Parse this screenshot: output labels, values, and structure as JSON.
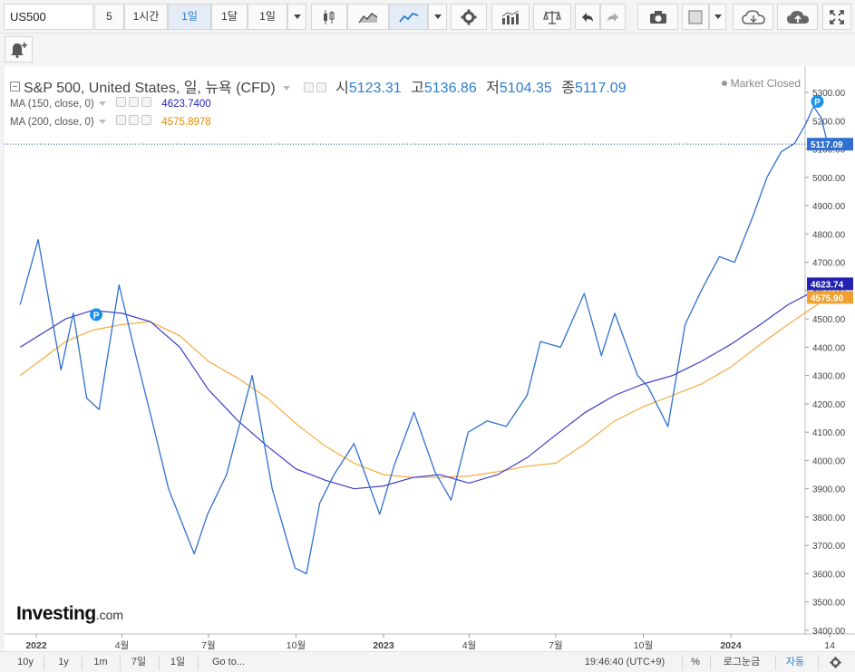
{
  "toolbar": {
    "symbol": "US500",
    "intervals": [
      "5",
      "1시간",
      "1일",
      "1달",
      "1일"
    ],
    "active_interval_index": 2,
    "icons": [
      "candlestick-icon",
      "area-chart-icon",
      "line-chart-icon",
      "settings-icon",
      "bar-indicator-icon",
      "scale-icon",
      "undo-icon",
      "redo-icon",
      "camera-icon",
      "color-box-icon",
      "cloud-download-icon",
      "cloud-upload-icon",
      "fullscreen-icon"
    ]
  },
  "alert_icon": "bell-plus-icon",
  "header": {
    "title": "S&P 500, United States, 일, 뉴욕 (CFD)",
    "ohlc": [
      {
        "label": "시",
        "value": "5123.31"
      },
      {
        "label": "고",
        "value": "5136.86"
      },
      {
        "label": "저",
        "value": "5104.35"
      },
      {
        "label": "종",
        "value": "5117.09"
      }
    ],
    "market_status": "Market Closed"
  },
  "indicators": [
    {
      "label": "MA (150, close, 0)",
      "value": "4623.7400",
      "color": "#2323b0"
    },
    {
      "label": "MA (200, close, 0)",
      "value": "4575.8978",
      "color": "#f0a030"
    }
  ],
  "colors": {
    "price": "#2f6fd0",
    "ma150": "#3c3cc8",
    "ma200": "#f5a93c",
    "price_tag": "#2f6fd0",
    "ma150_tag": "#2323b0",
    "ma200_tag": "#f0a030"
  },
  "logo": {
    "main": "Investing",
    "suffix": ".com"
  },
  "chart_data": {
    "type": "line",
    "ylim": [
      3400,
      5350
    ],
    "y_ticks": [
      "5300.00",
      "5200.00",
      "5100.00",
      "5000.00",
      "4900.00",
      "4800.00",
      "4700.00",
      "4600.00",
      "4500.00",
      "4400.00",
      "4300.00",
      "4200.00",
      "4100.00",
      "4000.00",
      "3900.00",
      "3800.00",
      "3700.00",
      "3600.00",
      "3500.00",
      "3400.00"
    ],
    "x_ticks": [
      "2022",
      "4월",
      "7월",
      "10월",
      "2023",
      "4월",
      "7월",
      "10월",
      "2024",
      "14"
    ],
    "last_price_label": "5117.09",
    "ma150_label": "4623.74",
    "ma200_label": "4575.90",
    "series": [
      {
        "name": "S&P 500",
        "x": [
          "2021-12-15",
          "2022-01-03",
          "2022-01-27",
          "2022-02-09",
          "2022-02-23",
          "2022-03-08",
          "2022-03-29",
          "2022-04-15",
          "2022-05-02",
          "2022-05-20",
          "2022-06-16",
          "2022-06-30",
          "2022-07-20",
          "2022-08-16",
          "2022-09-06",
          "2022-09-30",
          "2022-10-12",
          "2022-10-26",
          "2022-11-10",
          "2022-12-01",
          "2022-12-28",
          "2023-01-12",
          "2023-02-02",
          "2023-02-24",
          "2023-03-13",
          "2023-03-31",
          "2023-04-20",
          "2023-05-10",
          "2023-06-01",
          "2023-06-15",
          "2023-07-06",
          "2023-07-31",
          "2023-08-18",
          "2023-09-01",
          "2023-09-25",
          "2023-10-06",
          "2023-10-27",
          "2023-11-14",
          "2023-12-01",
          "2023-12-20",
          "2024-01-05",
          "2024-01-24",
          "2024-02-08",
          "2024-02-23",
          "2024-03-08",
          "2024-03-20",
          "2024-03-28",
          "2024-04-05",
          "2024-04-12"
        ],
        "y": [
          4550,
          4780,
          4320,
          4520,
          4220,
          4180,
          4620,
          4380,
          4150,
          3900,
          3670,
          3810,
          3950,
          4300,
          3900,
          3620,
          3600,
          3850,
          3950,
          4060,
          3810,
          3980,
          4170,
          3960,
          3860,
          4100,
          4140,
          4120,
          4230,
          4420,
          4400,
          4590,
          4370,
          4520,
          4300,
          4260,
          4120,
          4480,
          4600,
          4720,
          4700,
          4860,
          5000,
          5090,
          5120,
          5190,
          5250,
          5210,
          5117.09
        ]
      },
      {
        "name": "MA (150, close, 0)",
        "x": [
          "2021-12-15",
          "2022-02-01",
          "2022-03-01",
          "2022-04-01",
          "2022-05-01",
          "2022-06-01",
          "2022-07-01",
          "2022-08-01",
          "2022-09-01",
          "2022-10-01",
          "2022-11-01",
          "2022-12-01",
          "2023-01-01",
          "2023-02-01",
          "2023-03-01",
          "2023-04-01",
          "2023-05-01",
          "2023-06-01",
          "2023-07-01",
          "2023-08-01",
          "2023-09-01",
          "2023-10-01",
          "2023-11-01",
          "2023-12-01",
          "2024-01-01",
          "2024-02-01",
          "2024-03-01",
          "2024-04-12"
        ],
        "y": [
          4400,
          4500,
          4530,
          4520,
          4490,
          4400,
          4250,
          4140,
          4050,
          3970,
          3930,
          3900,
          3910,
          3940,
          3950,
          3920,
          3950,
          4010,
          4090,
          4170,
          4230,
          4270,
          4300,
          4350,
          4410,
          4480,
          4550,
          4623.74
        ]
      },
      {
        "name": "MA (200, close, 0)",
        "x": [
          "2021-12-15",
          "2022-02-01",
          "2022-03-01",
          "2022-04-01",
          "2022-05-01",
          "2022-06-01",
          "2022-07-01",
          "2022-08-01",
          "2022-09-01",
          "2022-10-01",
          "2022-11-01",
          "2022-12-01",
          "2023-01-01",
          "2023-02-01",
          "2023-03-01",
          "2023-04-01",
          "2023-05-01",
          "2023-06-01",
          "2023-07-01",
          "2023-08-01",
          "2023-09-01",
          "2023-10-01",
          "2023-11-01",
          "2023-12-01",
          "2024-01-01",
          "2024-02-01",
          "2024-03-01",
          "2024-04-12"
        ],
        "y": [
          4300,
          4420,
          4460,
          4480,
          4490,
          4440,
          4350,
          4290,
          4220,
          4130,
          4050,
          3990,
          3950,
          3940,
          3940,
          3945,
          3960,
          3980,
          3990,
          4060,
          4140,
          4190,
          4230,
          4270,
          4330,
          4410,
          4480,
          4575.9
        ]
      }
    ]
  },
  "bottom": {
    "ranges": [
      "10y",
      "1y",
      "1m",
      "7일",
      "1일"
    ],
    "goto": "Go to...",
    "time": "19:46:40 (UTC+9)",
    "percent": "%",
    "log": "로그눈금",
    "auto": "자동",
    "settings_icon": "gear-icon"
  }
}
